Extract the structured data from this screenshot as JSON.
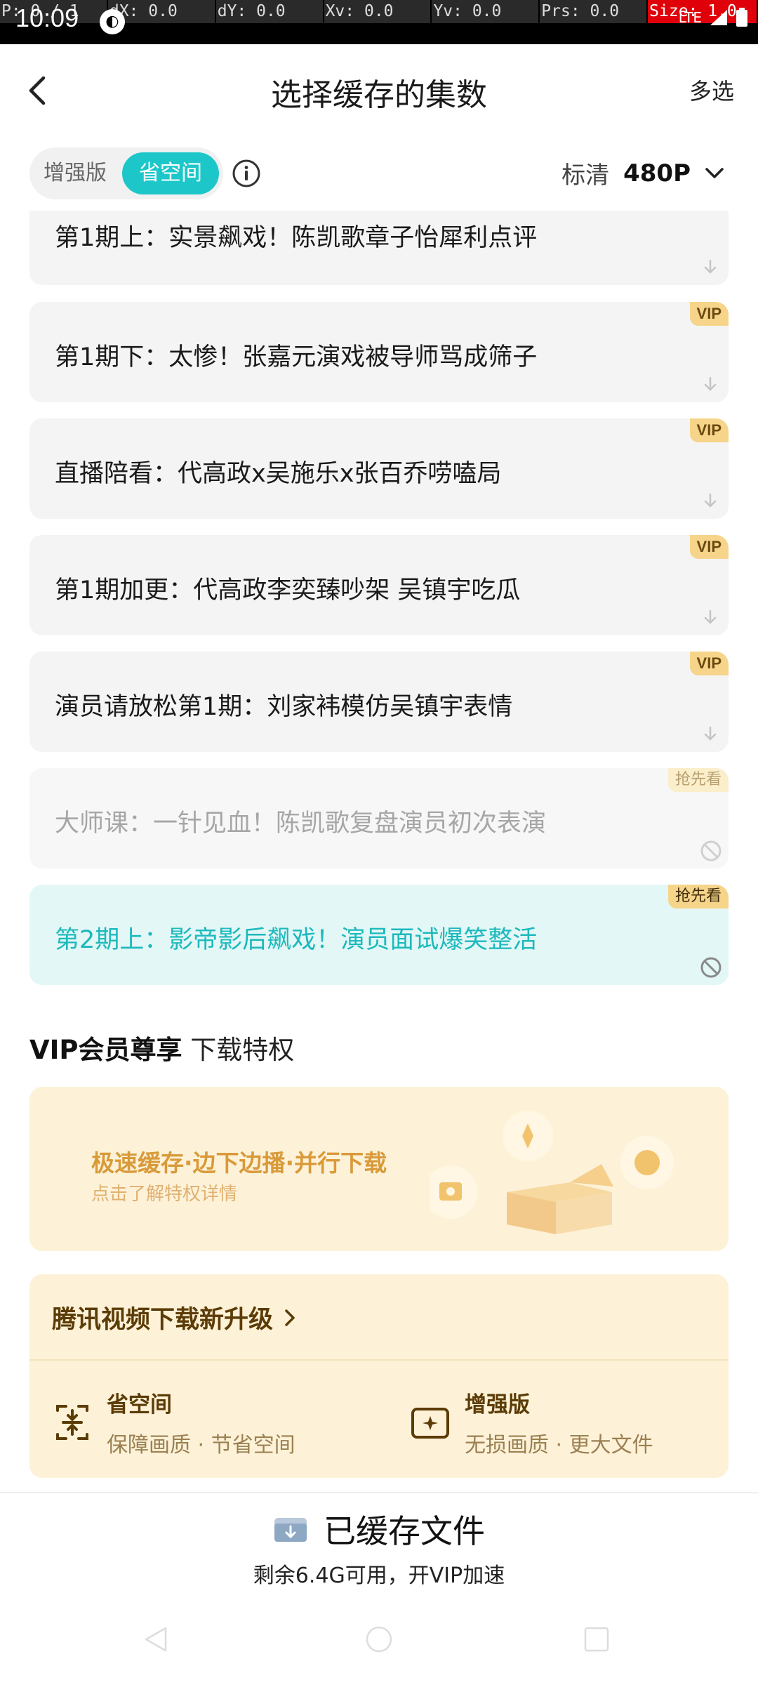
{
  "dev_overlay": {
    "cells": [
      "P: 0 / 1",
      "dX: 0.0",
      "dY: 0.0",
      "Xv: 0.0",
      "Yv: 0.0",
      "Prs: 0.0",
      "Size: 1.0"
    ]
  },
  "status_bar": {
    "time": "10:09",
    "network": "LTE"
  },
  "header": {
    "title": "选择缓存的集数",
    "multi_select": "多选"
  },
  "toolbar": {
    "mode_enhanced": "增强版",
    "mode_save_space": "省空间",
    "selected_mode": "省空间",
    "quality_label": "标清",
    "quality_value": "480P"
  },
  "episodes": [
    {
      "title": "第1期上：实景飙戏！陈凯歌章子怡犀利点评",
      "badge": "",
      "state": "downloadable"
    },
    {
      "title": "第1期下：太惨！张嘉元演戏被导师骂成筛子",
      "badge": "VIP",
      "state": "downloadable"
    },
    {
      "title": "直播陪看：代高政x吴施乐x张百乔唠嗑局",
      "badge": "VIP",
      "state": "downloadable"
    },
    {
      "title": "第1期加更：代高政李奕臻吵架 吴镇宇吃瓜",
      "badge": "VIP",
      "state": "downloadable"
    },
    {
      "title": "演员请放松第1期：刘家袆模仿吴镇宇表情",
      "badge": "VIP",
      "state": "downloadable"
    },
    {
      "title": "大师课：一针见血！陈凯歌复盘演员初次表演",
      "badge": "抢先看",
      "state": "disabled"
    },
    {
      "title": "第2期上：影帝影后飙戏！演员面试爆笑整活",
      "badge": "抢先看",
      "state": "active-disabled"
    }
  ],
  "vip_section": {
    "heading_bold": "VIP会员尊享",
    "heading_rest": "下载特权",
    "banner_title": "极速缓存·边下边播·并行下载",
    "banner_sub": "点击了解特权详情"
  },
  "upgrade": {
    "title": "腾讯视频下载新升级",
    "features": [
      {
        "name": "省空间",
        "desc": "保障画质 · 节省空间",
        "icon": "compress-icon"
      },
      {
        "name": "增强版",
        "desc": "无损画质 · 更大文件",
        "icon": "enhanced-icon"
      }
    ]
  },
  "cached": {
    "title": "已缓存文件",
    "subtitle": "剩余6.4G可用，开VIP加速"
  },
  "colors": {
    "accent": "#1dc7c9",
    "vip_gold": "#f6d48a",
    "card_bg": "#f4f4f4",
    "upgrade_bg": "#fdf2d8"
  }
}
